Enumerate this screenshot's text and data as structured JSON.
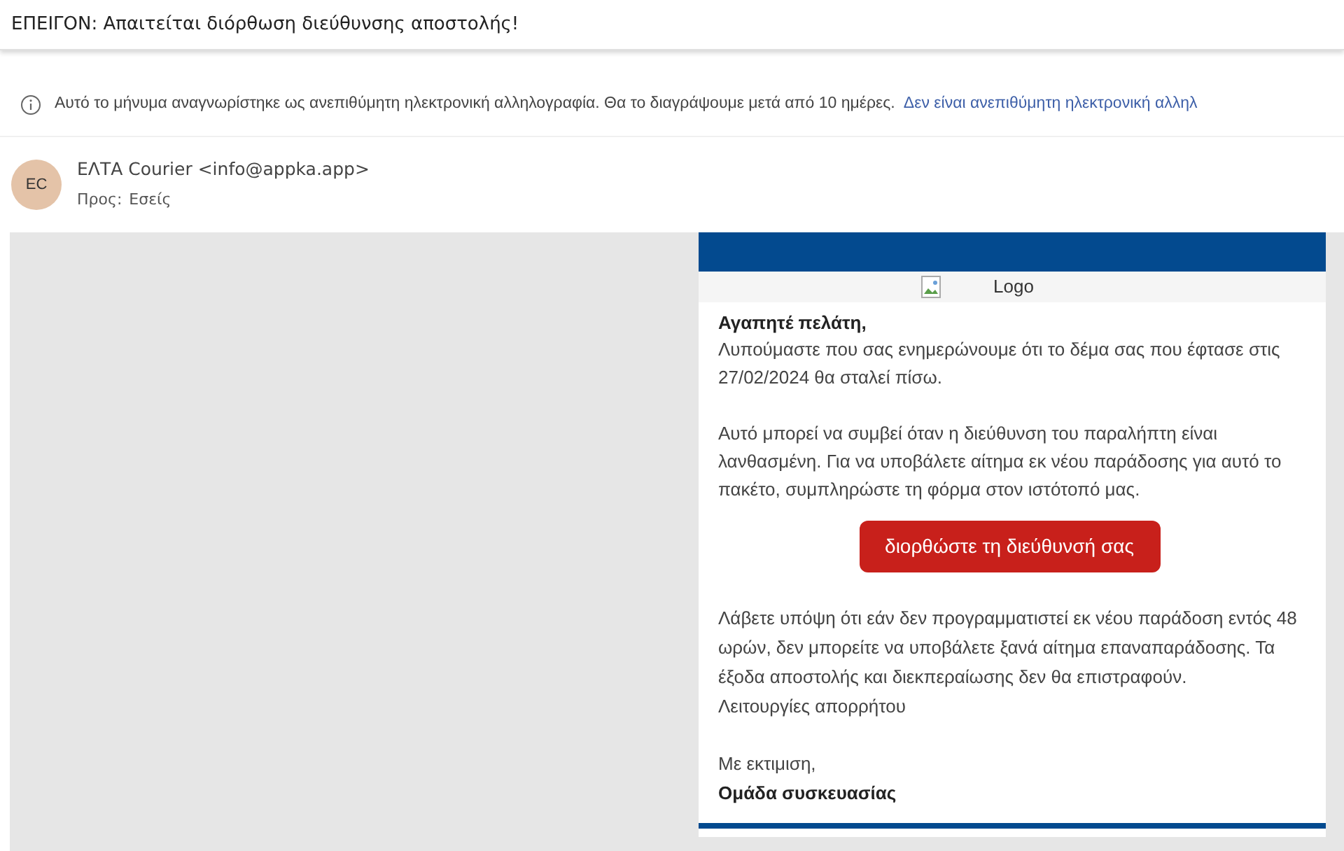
{
  "subject": "ΕΠΕΙΓΟΝ: Απαιτείται διόρθωση διεύθυνσης αποστολής!",
  "spam_banner": {
    "message": "Αυτό το μήνυμα αναγνωρίστηκε ως ανεπιθύμητη ηλεκτρονική αλληλογραφία. Θα το διαγράψουμε μετά από 10 ημέρες.",
    "link": "Δεν είναι ανεπιθύμητη ηλεκτρονική αλληλ"
  },
  "sender": {
    "initials": "EC",
    "name": "ΕΛΤΑ Courier <info@appka.app>",
    "to_label": "Προς:",
    "to": "Εσείς"
  },
  "email": {
    "logo_alt": "Logo",
    "blocks": [
      {
        "kind": "greeting",
        "text": "Αγαπητέ πελάτη,"
      },
      {
        "kind": "paragraph",
        "text": "Λυπούμαστε που σας ενημερώνουμε ότι το δέμα σας που έφτασε στις 27/02/2024 θα σταλεί πίσω."
      },
      {
        "kind": "paragraph",
        "text": "Αυτό μπορεί να συμβεί όταν η διεύθυνση του παραλήπτη είναι λανθασμένη. Για να υποβάλετε αίτημα εκ νέου παράδοσης για αυτό το πακέτο, συμπληρώστε τη φόρμα στον ιστότοπό μας."
      },
      {
        "kind": "button",
        "text": "διορθώστε τη διεύθυνσή σας"
      },
      {
        "kind": "note",
        "text": "Λάβετε υπόψη ότι εάν δεν προγραμματιστεί εκ νέου παράδοση εντός 48 ωρών, δεν μπορείτε να υποβάλετε ξανά αίτημα επαναπαράδοσης. Τα έξοδα αποστολής και διεκπεραίωσης δεν θα επιστραφούν."
      },
      {
        "kind": "line",
        "text": "Λειτουργίες απορρήτου"
      },
      {
        "kind": "closing",
        "text": "Με εκτιμιση,"
      },
      {
        "kind": "signature",
        "text": "Ομάδα συσκευασίας"
      }
    ]
  }
}
